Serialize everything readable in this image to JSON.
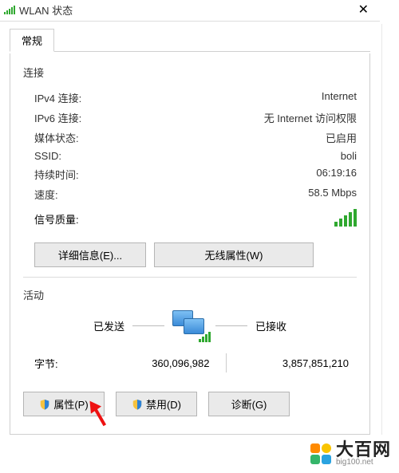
{
  "title": "WLAN 状态",
  "tab": "常规",
  "section_connection": "连接",
  "rows": {
    "ipv4_l": "IPv4 连接:",
    "ipv4_v": "Internet",
    "ipv6_l": "IPv6 连接:",
    "ipv6_v": "无 Internet 访问权限",
    "media_l": "媒体状态:",
    "media_v": "已启用",
    "ssid_l": "SSID:",
    "ssid_v": "boli",
    "dur_l": "持续时间:",
    "dur_v": "06:19:16",
    "spd_l": "速度:",
    "spd_v": "58.5 Mbps",
    "sig_l": "信号质量:"
  },
  "buttons": {
    "details": "详细信息(E)...",
    "wireless": "无线属性(W)",
    "props": "属性(P)",
    "disable": "禁用(D)",
    "diag": "诊断(G)"
  },
  "section_activity": "活动",
  "activity": {
    "sent_l": "已发送",
    "recv_l": "已接收",
    "bytes_l": "字节:",
    "sent_v": "360,096,982",
    "recv_v": "3,857,851,210"
  },
  "watermark": {
    "name": "大百网",
    "url": "big100.net"
  }
}
